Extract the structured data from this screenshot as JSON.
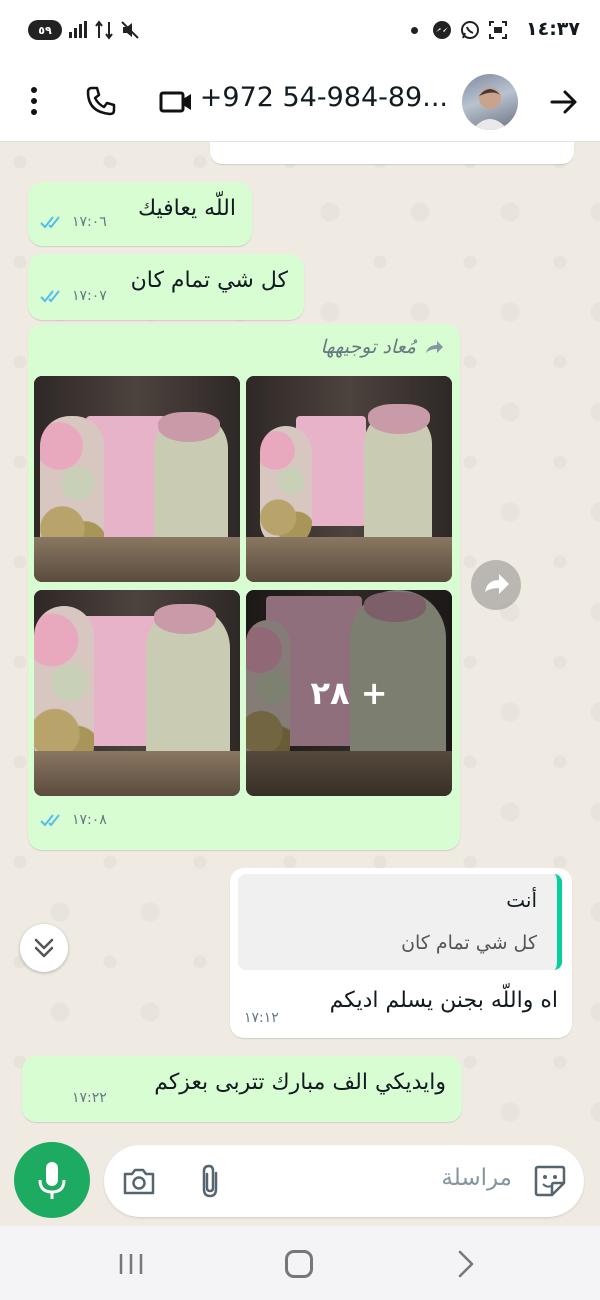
{
  "status_bar": {
    "time": "١٤:٣٧",
    "battery": "٥٩"
  },
  "header": {
    "contact_title": "+972 54-984-89..."
  },
  "messages": [
    {
      "text": "اللّه يعافيك",
      "time": "١٧:٠٦",
      "status": "read"
    },
    {
      "text": "كل شي تمام كان",
      "time": "١٧:٠٧",
      "status": "read"
    },
    {
      "forwarded_label": "مُعاد توجيهها",
      "more_count": "+ ٢٨",
      "time": "١٧:٠٨",
      "status": "read"
    },
    {
      "quote_author": "أنت",
      "quote_text": "كل شي تمام كان",
      "text": "اه واللّه بجنن يسلم اديكم",
      "time": "١٧:١٢"
    },
    {
      "text": "وايديكي الف مبارك تتربى بعزكم",
      "time": "١٧:٢٢"
    }
  ],
  "input": {
    "placeholder": "مراسلة"
  },
  "icons": {
    "back": "arrow-right-icon",
    "video": "video-camera-icon",
    "call": "phone-icon",
    "menu": "more-vertical-icon",
    "read_ticks": "double-check-icon",
    "forward": "forward-icon",
    "share": "share-forward-icon",
    "scroll": "chevron-double-down-icon",
    "mic": "microphone-icon",
    "camera": "camera-icon",
    "attach": "paperclip-icon",
    "emoji": "sticker-icon"
  },
  "colors": {
    "outgoing_bubble": "#d9fdd3",
    "incoming_bubble": "#ffffff",
    "accent_green": "#1daa61",
    "read_tick_blue": "#53bdeb",
    "chat_background": "#efeae2"
  }
}
